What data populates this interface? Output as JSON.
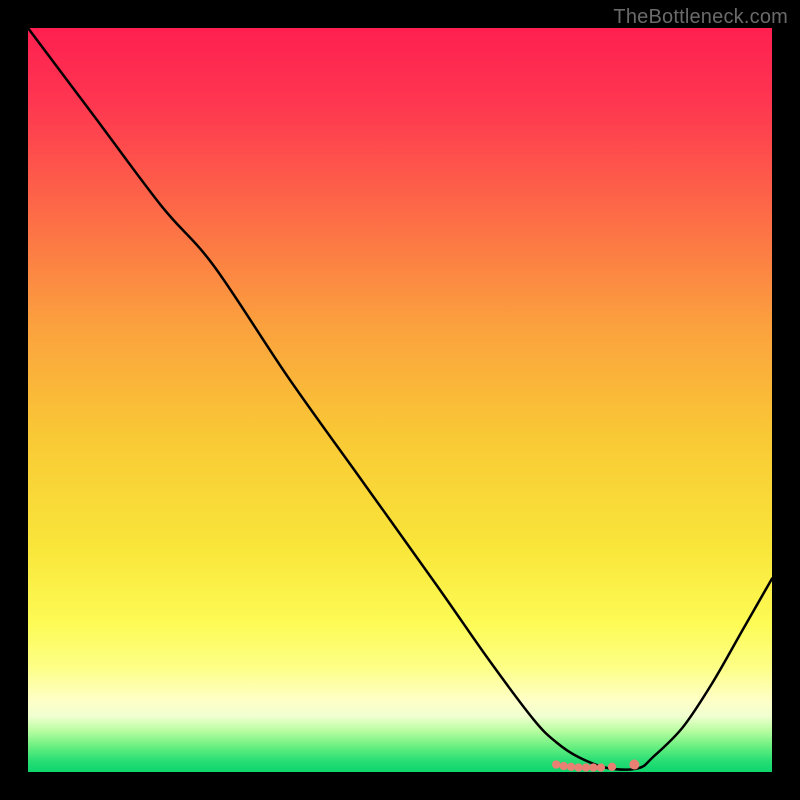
{
  "watermark": "TheBottleneck.com",
  "chart_data": {
    "type": "line",
    "title": "",
    "xlabel": "",
    "ylabel": "",
    "xlim": [
      0,
      100
    ],
    "ylim": [
      0,
      100
    ],
    "grid": false,
    "series": [
      {
        "name": "curve",
        "x": [
          0,
          9,
          18,
          25,
          35,
          45,
          55,
          62,
          68,
          71,
          74,
          78,
          82,
          84,
          88,
          92,
          96,
          100
        ],
        "y": [
          100,
          88,
          76,
          68,
          53,
          39,
          25,
          15,
          7,
          4,
          2,
          0.5,
          0.5,
          2,
          6,
          12,
          19,
          26
        ]
      }
    ],
    "markers": {
      "name": "cluster",
      "color": "#e88074",
      "points": [
        {
          "x": 71.0,
          "y": 1.0
        },
        {
          "x": 72.0,
          "y": 0.8
        },
        {
          "x": 73.0,
          "y": 0.7
        },
        {
          "x": 74.0,
          "y": 0.6
        },
        {
          "x": 75.0,
          "y": 0.6
        },
        {
          "x": 76.0,
          "y": 0.6
        },
        {
          "x": 77.0,
          "y": 0.6
        },
        {
          "x": 78.5,
          "y": 0.7
        },
        {
          "x": 81.5,
          "y": 1.0
        }
      ]
    },
    "gradient_stops": [
      {
        "offset": 0.0,
        "color": "#fe2050"
      },
      {
        "offset": 0.1,
        "color": "#fe3650"
      },
      {
        "offset": 0.25,
        "color": "#fd6b47"
      },
      {
        "offset": 0.4,
        "color": "#fba13e"
      },
      {
        "offset": 0.55,
        "color": "#f9c935"
      },
      {
        "offset": 0.7,
        "color": "#f9e63a"
      },
      {
        "offset": 0.8,
        "color": "#fdfb55"
      },
      {
        "offset": 0.86,
        "color": "#fdff87"
      },
      {
        "offset": 0.905,
        "color": "#feffc8"
      },
      {
        "offset": 0.925,
        "color": "#f0ffd0"
      },
      {
        "offset": 0.945,
        "color": "#b7fda0"
      },
      {
        "offset": 0.965,
        "color": "#6cf081"
      },
      {
        "offset": 0.985,
        "color": "#28de74"
      },
      {
        "offset": 1.0,
        "color": "#0ed56d"
      }
    ]
  }
}
